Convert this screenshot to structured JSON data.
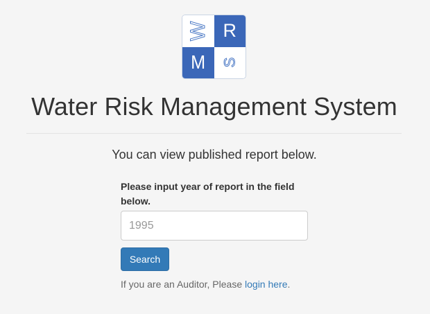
{
  "logo": {
    "letters": [
      "W",
      "R",
      "M",
      "S"
    ]
  },
  "header": {
    "title": "Water Risk Management System"
  },
  "main": {
    "subtitle": "You can view published report below.",
    "field_label": "Please input year of report in the field below.",
    "year_input": {
      "placeholder": "1995",
      "value": ""
    },
    "search_label": "Search",
    "auditor_prefix": "If you are an Auditor, Please ",
    "login_link": "login here",
    "auditor_suffix": "."
  },
  "colors": {
    "brand_blue": "#3b67b8",
    "button_blue": "#337ab7",
    "link_blue": "#337ab7",
    "background": "#f5f5f5",
    "text": "#333333"
  }
}
